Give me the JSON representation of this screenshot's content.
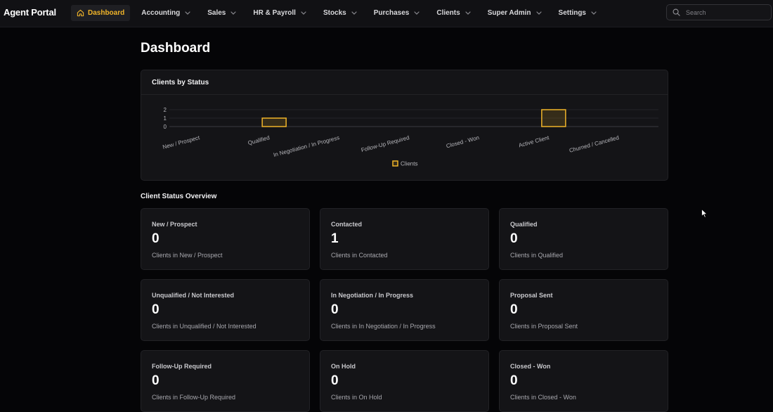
{
  "app": {
    "title": "Agent Portal"
  },
  "nav": {
    "items": [
      {
        "label": "Dashboard",
        "active": true,
        "icon": "home-icon"
      },
      {
        "label": "Accounting"
      },
      {
        "label": "Sales"
      },
      {
        "label": "HR & Payroll"
      },
      {
        "label": "Stocks"
      },
      {
        "label": "Purchases"
      },
      {
        "label": "Clients"
      },
      {
        "label": "Super Admin"
      },
      {
        "label": "Settings"
      }
    ]
  },
  "search": {
    "placeholder": "Search",
    "value": ""
  },
  "page": {
    "title": "Dashboard"
  },
  "chart_card": {
    "title": "Clients by Status"
  },
  "chart_data": {
    "type": "bar",
    "title": "Clients by Status",
    "categories": [
      "New / Prospect",
      "Qualified",
      "In Negotiation / In Progress",
      "Follow-Up Required",
      "Closed - Won",
      "Active Client",
      "Churned / Cancelled"
    ],
    "tick_labels": [
      "New / Prospect",
      "Qualified",
      "In Negotiation / In Progress",
      "Follow-Up Required",
      "Closed - Won",
      "Active Client",
      "Churned / Cancelled"
    ],
    "series": [
      {
        "name": "Clients",
        "values": [
          0,
          1,
          0,
          0,
          0,
          2,
          0
        ],
        "color": "#f0b429"
      }
    ],
    "ylim": [
      0,
      2
    ],
    "yticks": [
      0,
      1,
      2
    ],
    "grid": true,
    "legend": "bottom-center"
  },
  "overview": {
    "title": "Client Status Overview",
    "cards": [
      {
        "label": "New / Prospect",
        "value": "0",
        "desc": "Clients in New / Prospect"
      },
      {
        "label": "Contacted",
        "value": "1",
        "desc": "Clients in Contacted"
      },
      {
        "label": "Qualified",
        "value": "0",
        "desc": "Clients in Qualified"
      },
      {
        "label": "Unqualified / Not Interested",
        "value": "0",
        "desc": "Clients in Unqualified / Not Interested"
      },
      {
        "label": "In Negotiation / In Progress",
        "value": "0",
        "desc": "Clients in In Negotiation / In Progress"
      },
      {
        "label": "Proposal Sent",
        "value": "0",
        "desc": "Clients in Proposal Sent"
      },
      {
        "label": "Follow-Up Required",
        "value": "0",
        "desc": "Clients in Follow-Up Required"
      },
      {
        "label": "On Hold",
        "value": "0",
        "desc": "Clients in On Hold"
      },
      {
        "label": "Closed - Won",
        "value": "0",
        "desc": "Clients in Closed - Won"
      }
    ]
  },
  "colors": {
    "accent": "#f0b429",
    "background": "#050507",
    "card": "#141417"
  }
}
